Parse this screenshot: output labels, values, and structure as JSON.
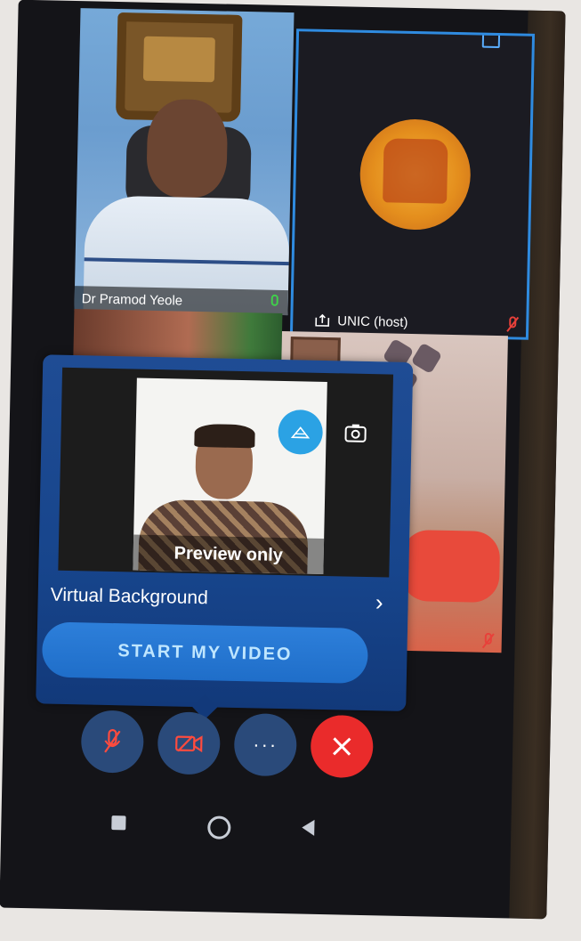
{
  "tiles": {
    "participant1": {
      "name": "Dr Pramod Yeole"
    },
    "participant2": {
      "name": "UNIC (host)"
    }
  },
  "preview": {
    "caption": "Preview only",
    "virtual_background_label": "Virtual Background",
    "start_video_label": "START MY VIDEO"
  },
  "colors": {
    "accent_blue": "#2f8be0",
    "end_call_red": "#ea2b2b",
    "popup_blue": "#1f4c94"
  },
  "icons": {
    "mute": "mic-off-icon",
    "video_off": "video-off-icon",
    "more": "more-icon",
    "end": "close-icon"
  }
}
